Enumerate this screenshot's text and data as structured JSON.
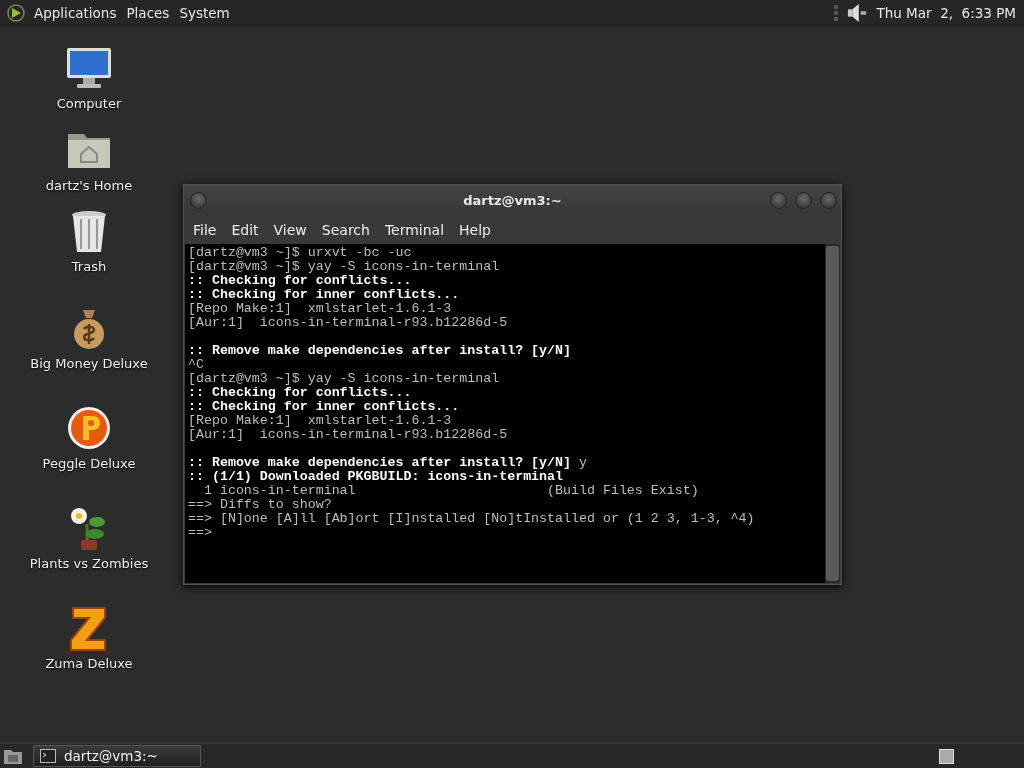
{
  "top_panel": {
    "menus": [
      "Applications",
      "Places",
      "System"
    ],
    "clock": "Thu Mar  2,  6:33 PM"
  },
  "desktop_icons": [
    {
      "kind": "computer",
      "label": "Computer"
    },
    {
      "kind": "home",
      "label": "dartz's Home"
    },
    {
      "kind": "trash",
      "label": "Trash"
    },
    {
      "kind": "money",
      "label": "Big Money Deluxe"
    },
    {
      "kind": "peggle",
      "label": "Peggle Deluxe"
    },
    {
      "kind": "plants",
      "label": "Plants vs Zombies"
    },
    {
      "kind": "zuma",
      "label": "Zuma Deluxe"
    }
  ],
  "window": {
    "title": "dartz@vm3:~",
    "menus": [
      "File",
      "Edit",
      "View",
      "Search",
      "Terminal",
      "Help"
    ],
    "lines": [
      {
        "kind": "normal",
        "text": "[dartz@vm3 ~]$ urxvt -bc -uc"
      },
      {
        "kind": "normal",
        "text": "[dartz@vm3 ~]$ yay -S icons-in-terminal"
      },
      {
        "kind": "bold",
        "text": ":: Checking for conflicts..."
      },
      {
        "kind": "bold",
        "text": ":: Checking for inner conflicts..."
      },
      {
        "kind": "normal",
        "text": "[Repo Make:1]  xmlstarlet-1.6.1-3"
      },
      {
        "kind": "normal",
        "text": "[Aur:1]  icons-in-terminal-r93.b12286d-5"
      },
      {
        "kind": "blank"
      },
      {
        "kind": "bold",
        "text": ":: Remove make dependencies after install? [y/N]"
      },
      {
        "kind": "normal",
        "text": "^C"
      },
      {
        "kind": "normal",
        "text": "[dartz@vm3 ~]$ yay -S icons-in-terminal"
      },
      {
        "kind": "bold",
        "text": ":: Checking for conflicts..."
      },
      {
        "kind": "bold",
        "text": ":: Checking for inner conflicts..."
      },
      {
        "kind": "normal",
        "text": "[Repo Make:1]  xmlstarlet-1.6.1-3"
      },
      {
        "kind": "normal",
        "text": "[Aur:1]  icons-in-terminal-r93.b12286d-5"
      },
      {
        "kind": "blank"
      },
      {
        "kind": "normal",
        "text": "**:: Remove make dependencies after install? [y/N]** y"
      },
      {
        "kind": "bold",
        "text": ":: (1/1) Downloaded PKGBUILD: icons-in-terminal"
      },
      {
        "kind": "normal",
        "text": "  1 icons-in-terminal                        (Build Files Exist)"
      },
      {
        "kind": "normal",
        "text": "==> Diffs to show?"
      },
      {
        "kind": "normal",
        "text": "==> [N]one [A]ll [Ab]ort [I]nstalled [No]tInstalled or (1 2 3, 1-3, ^4)"
      },
      {
        "kind": "normal",
        "text": "==>"
      }
    ]
  },
  "taskbar": {
    "tasks": [
      {
        "label": "dartz@vm3:~",
        "selected": false
      }
    ]
  }
}
